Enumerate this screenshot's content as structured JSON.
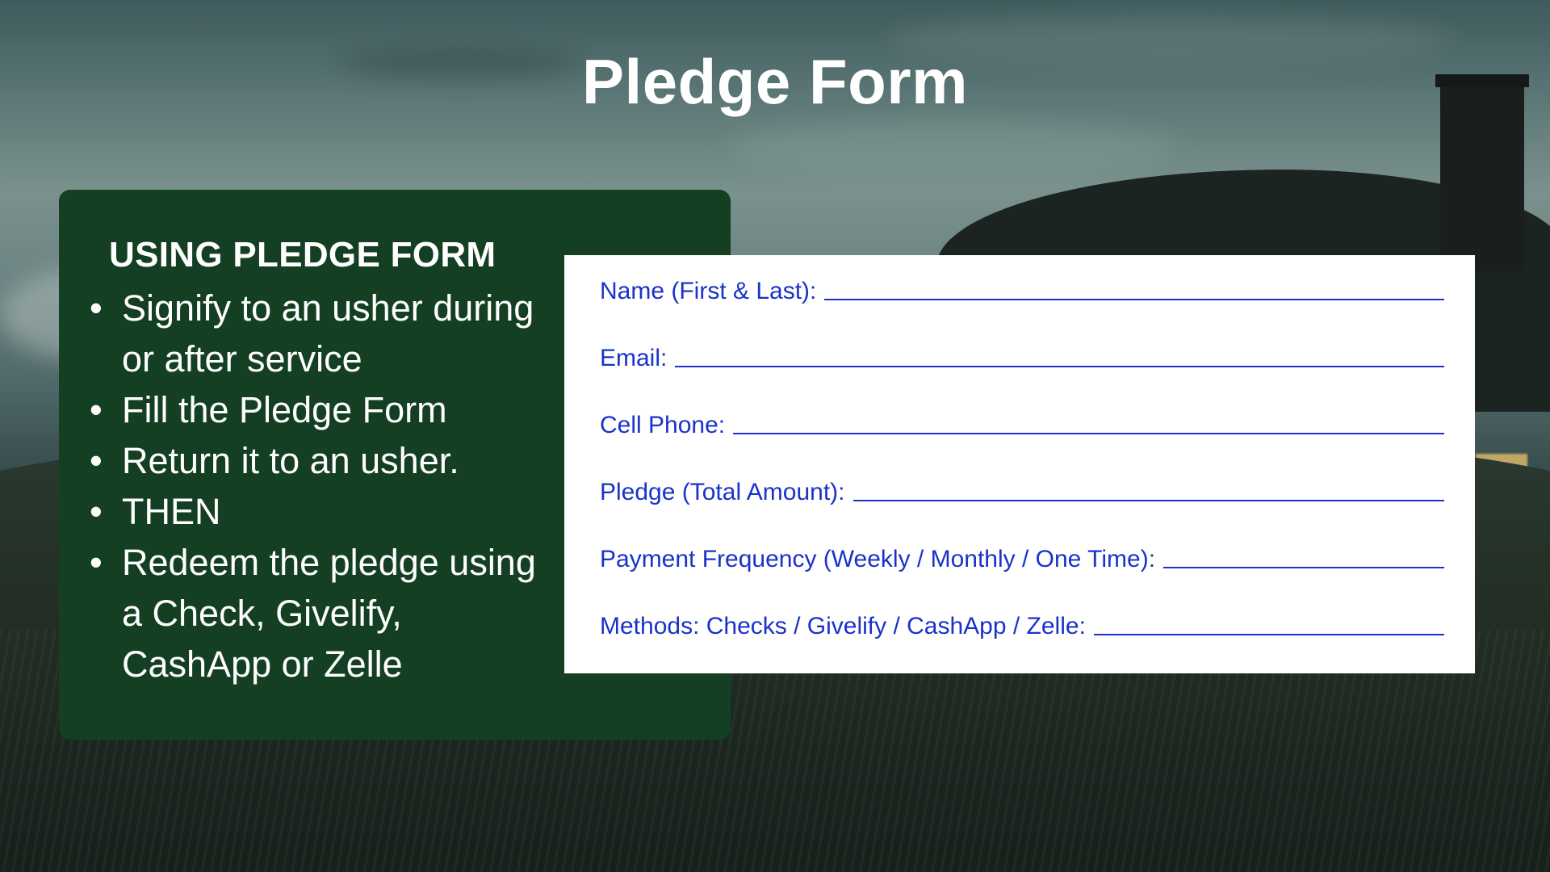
{
  "slide": {
    "title": "Pledge Form"
  },
  "panel": {
    "heading": "USING PLEDGE FORM",
    "steps": [
      "Signify to an usher during or after service",
      "Fill the Pledge Form",
      "Return it to an usher.",
      "THEN",
      "Redeem the pledge using a Check, Givelify, CashApp or Zelle"
    ]
  },
  "form": {
    "fields": [
      "Name (First & Last):",
      "Email:",
      "Cell Phone:",
      "Pledge (Total Amount):",
      "Payment Frequency (Weekly / Monthly / One Time):",
      "Methods: Checks / Givelify / CashApp / Zelle:"
    ]
  },
  "colors": {
    "panel_bg": "#143f22",
    "form_text": "#1a32c9",
    "title_text": "#ffffff"
  }
}
